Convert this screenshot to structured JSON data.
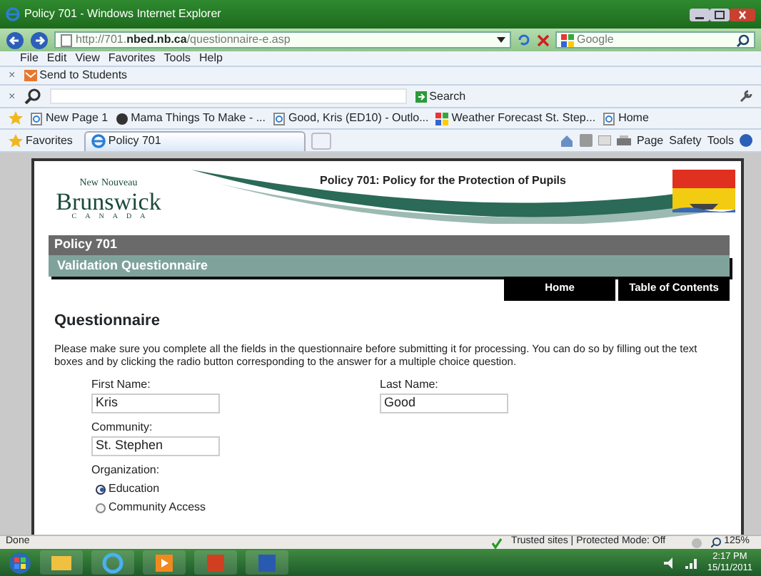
{
  "window": {
    "title": "Policy 701 - Windows Internet Explorer"
  },
  "address_bar": {
    "url_prefix": "http://701.",
    "url_domain": "nbed.nb.ca",
    "url_path": "/questionnaire-e.asp"
  },
  "search_box": {
    "placeholder": "Google"
  },
  "menu": [
    "File",
    "Edit",
    "View",
    "Favorites",
    "Tools",
    "Help"
  ],
  "addon_toolbar": {
    "close": "×",
    "button": "Send to Students"
  },
  "search_toolbar": {
    "close": "×",
    "search_button": "Search"
  },
  "favorites_bar": [
    {
      "label": "New Page 1",
      "kind": "page"
    },
    {
      "label": "Mama Things To Make - ...",
      "kind": "circle"
    },
    {
      "label": "Good, Kris (ED10) - Outlo...",
      "kind": "page"
    },
    {
      "label": "Weather Forecast St. Step...",
      "kind": "weather"
    },
    {
      "label": "Home",
      "kind": "page"
    }
  ],
  "tab_row": {
    "favorites": "Favorites",
    "tabs": [
      {
        "label": "Policy 701",
        "selected": true
      }
    ],
    "commands": [
      "Page",
      "Safety",
      "Tools"
    ]
  },
  "page": {
    "logo": {
      "new": "New",
      "nouveau": "Nouveau",
      "name": "Brunswick",
      "country": "CANADA"
    },
    "header_title": "Policy 701: Policy for the Protection of Pupils",
    "banner_title": "Policy 701",
    "banner_subtitle": "Validation Questionnaire",
    "nav": [
      "Home",
      "Table of Contents"
    ],
    "heading": "Questionnaire",
    "intro": "Please make sure you complete all the fields in the questionnaire before submitting it for processing. You can do so by filling out the text boxes and by clicking the radio button corresponding to the answer for a multiple choice question.",
    "name_fields": [
      {
        "label": "First Name:",
        "value": "Kris"
      },
      {
        "label": "Last Name:",
        "value": "Good"
      }
    ],
    "community": {
      "label": "Community:",
      "value": "St. Stephen"
    },
    "organization": {
      "label": "Organization:",
      "options": [
        {
          "label": "Education",
          "selected": true
        },
        {
          "label": "Community Access",
          "selected": false
        }
      ]
    }
  },
  "status_bar": {
    "status": "Done",
    "zone": "Trusted sites | Protected Mode: Off",
    "zoom": "125%"
  },
  "taskbar": {
    "time": "2:17 PM",
    "date": "15/11/2011"
  }
}
